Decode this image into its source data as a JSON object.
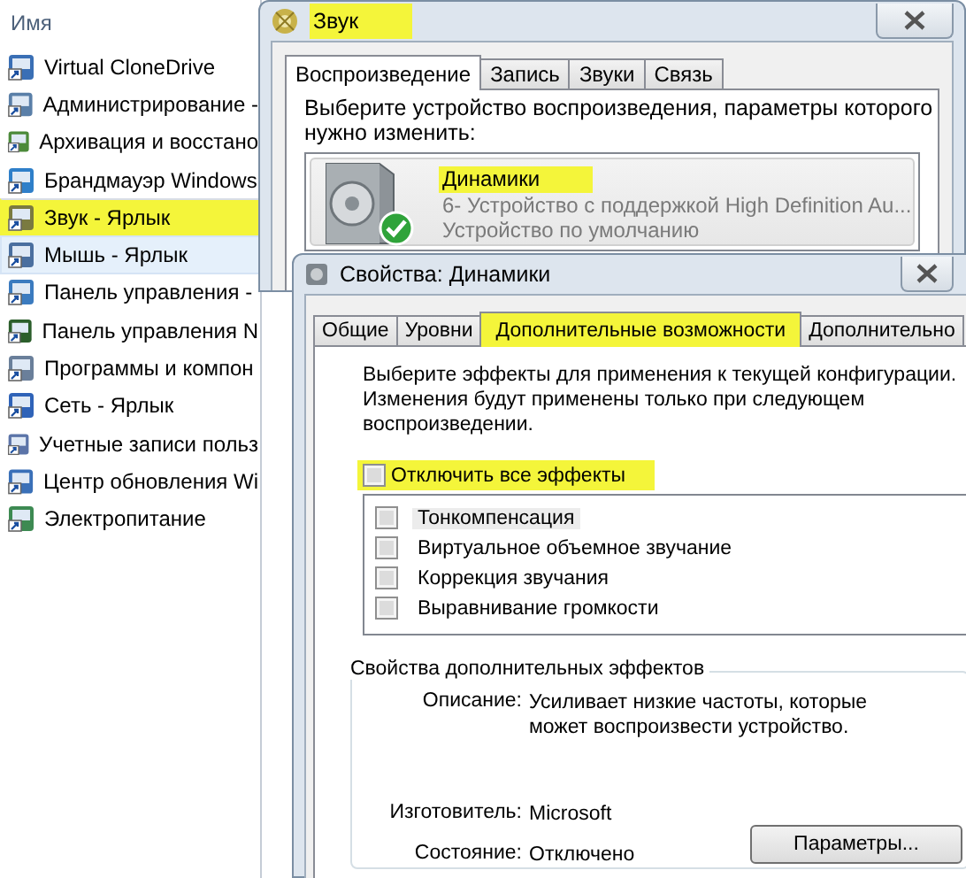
{
  "explorer": {
    "column_header": "Имя",
    "items": [
      {
        "label": "Virtual CloneDrive",
        "selected": false,
        "highlighted": false
      },
      {
        "label": "Администрирование -",
        "selected": false,
        "highlighted": false
      },
      {
        "label": "Архивация и восстано",
        "selected": false,
        "highlighted": false
      },
      {
        "label": "Брандмауэр Windows",
        "selected": false,
        "highlighted": false
      },
      {
        "label": "Звук - Ярлык",
        "selected": false,
        "highlighted": true
      },
      {
        "label": "Мышь - Ярлык",
        "selected": true,
        "highlighted": false
      },
      {
        "label": "Панель управления -",
        "selected": false,
        "highlighted": false
      },
      {
        "label": "Панель управления N",
        "selected": false,
        "highlighted": false
      },
      {
        "label": "Программы и компон",
        "selected": false,
        "highlighted": false
      },
      {
        "label": "Сеть - Ярлык",
        "selected": false,
        "highlighted": false
      },
      {
        "label": "Учетные записи польз",
        "selected": false,
        "highlighted": false
      },
      {
        "label": "Центр обновления Wi",
        "selected": false,
        "highlighted": false
      },
      {
        "label": "Электропитание",
        "selected": false,
        "highlighted": false
      }
    ]
  },
  "sound_window": {
    "title": "Звук",
    "title_highlighted": true,
    "tabs": [
      {
        "label": "Воспроизведение",
        "selected": true
      },
      {
        "label": "Запись",
        "selected": false
      },
      {
        "label": "Звуки",
        "selected": false
      },
      {
        "label": "Связь",
        "selected": false
      }
    ],
    "instruction": "Выберите устройство воспроизведения, параметры которого нужно изменить:",
    "devices": [
      {
        "name": "Динамики",
        "name_highlighted": true,
        "description": "6- Устройство с поддержкой High Definition Au...",
        "status": "Устройство по умолчанию",
        "default": true
      }
    ]
  },
  "properties_dialog": {
    "title": "Свойства: Динамики",
    "tabs": [
      {
        "label": "Общие",
        "selected": false,
        "highlighted": false
      },
      {
        "label": "Уровни",
        "selected": false,
        "highlighted": false
      },
      {
        "label": "Дополнительные возможности",
        "selected": true,
        "highlighted": true
      },
      {
        "label": "Дополнительно",
        "selected": false,
        "highlighted": false
      }
    ],
    "instruction": "Выберите эффекты для применения к текущей конфигурации. Изменения будут применены только при следующем воспроизведении.",
    "disable_all": {
      "label": "Отключить все эффекты",
      "checked": false,
      "highlighted": true
    },
    "effects": [
      {
        "label": "Тонкомпенсация",
        "checked": false,
        "selected": true
      },
      {
        "label": "Виртуальное объемное звучание",
        "checked": false,
        "selected": false
      },
      {
        "label": "Коррекция звучания",
        "checked": false,
        "selected": false
      },
      {
        "label": "Выравнивание громкости",
        "checked": false,
        "selected": false
      }
    ],
    "effect_properties": {
      "title": "Свойства дополнительных эффектов",
      "fields": [
        {
          "label": "Описание:",
          "value": "Усиливает низкие частоты, которые может воспроизвести устройство."
        },
        {
          "label": "Изготовитель:",
          "value": "Microsoft"
        },
        {
          "label": "Состояние:",
          "value": "Отключено"
        }
      ],
      "button": "Параметры..."
    }
  }
}
